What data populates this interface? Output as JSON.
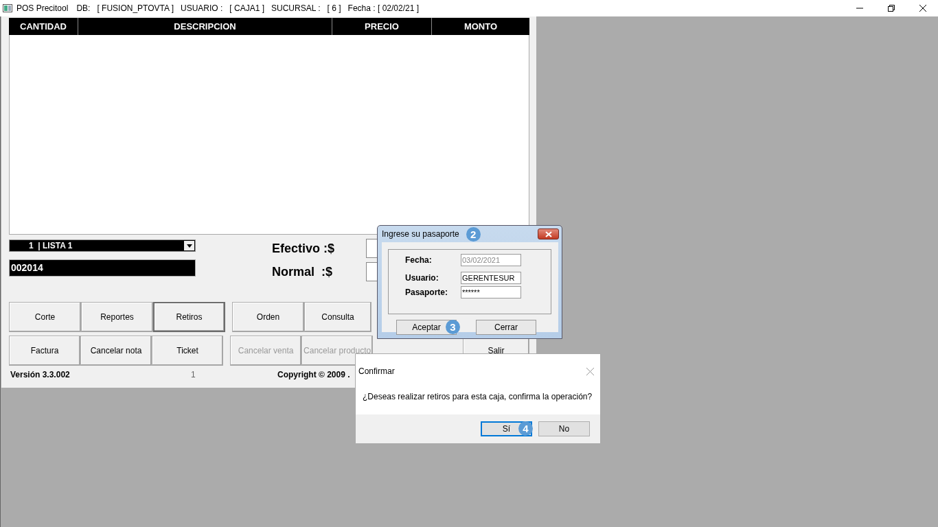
{
  "window": {
    "title_parts": [
      "POS Precitool",
      "DB:",
      "[ FUSION_PTOVTA ]",
      "USUARIO :",
      "[ CAJA1 ]",
      "SUCURSAL :",
      "[ 6 ]",
      "Fecha : [ 02/02/21 ]"
    ]
  },
  "table": {
    "columns": [
      "CANTIDAD",
      "DESCRIPCION",
      "PRECIO",
      "MONTO"
    ]
  },
  "price_list": {
    "value": "1  | LISTA 1"
  },
  "code_field": {
    "value": "002014"
  },
  "totals": [
    {
      "label": "Efectivo :$"
    },
    {
      "label": "Normal  :$"
    }
  ],
  "buttons": [
    {
      "label": "Corte",
      "disabled": false,
      "focused": false
    },
    {
      "label": "Reportes",
      "disabled": false,
      "focused": false
    },
    {
      "label": "Retiros",
      "disabled": false,
      "focused": true
    },
    {
      "label": "Orden",
      "disabled": false,
      "focused": false
    },
    {
      "label": "Consulta",
      "disabled": false,
      "focused": false
    },
    {
      "label": "Factura",
      "disabled": false,
      "focused": false
    },
    {
      "label": "Cancelar nota",
      "disabled": false,
      "focused": false
    },
    {
      "label": "Ticket",
      "disabled": false,
      "focused": false
    },
    {
      "label": "Cancelar venta",
      "disabled": true,
      "focused": false
    },
    {
      "label": "Cancelar producto",
      "disabled": true,
      "focused": false
    },
    {
      "label": "Salir",
      "disabled": false,
      "focused": false
    }
  ],
  "footer": {
    "version": "Versión 3.3.002",
    "page": "1",
    "copyright": "Copyright © 2009 ."
  },
  "passport_dialog": {
    "title": "Ingrese su pasaporte",
    "step": "2",
    "fields": [
      {
        "label": "Fecha:",
        "value": "03/02/2021",
        "disabled": true
      },
      {
        "label": "Usuario:",
        "value": "GERENTESUR",
        "disabled": false
      },
      {
        "label": "Pasaporte:",
        "value": "******",
        "disabled": false
      }
    ],
    "buttons": [
      {
        "label": "Aceptar",
        "step": "3"
      },
      {
        "label": "Cerrar"
      }
    ]
  },
  "confirm_dialog": {
    "title": "Confirmar",
    "message": "¿Deseas realizar retiros para esta caja, confirma la operación?",
    "buttons": [
      {
        "label": "Sí",
        "focused": true,
        "step": "4"
      },
      {
        "label": "No",
        "focused": false
      }
    ]
  }
}
